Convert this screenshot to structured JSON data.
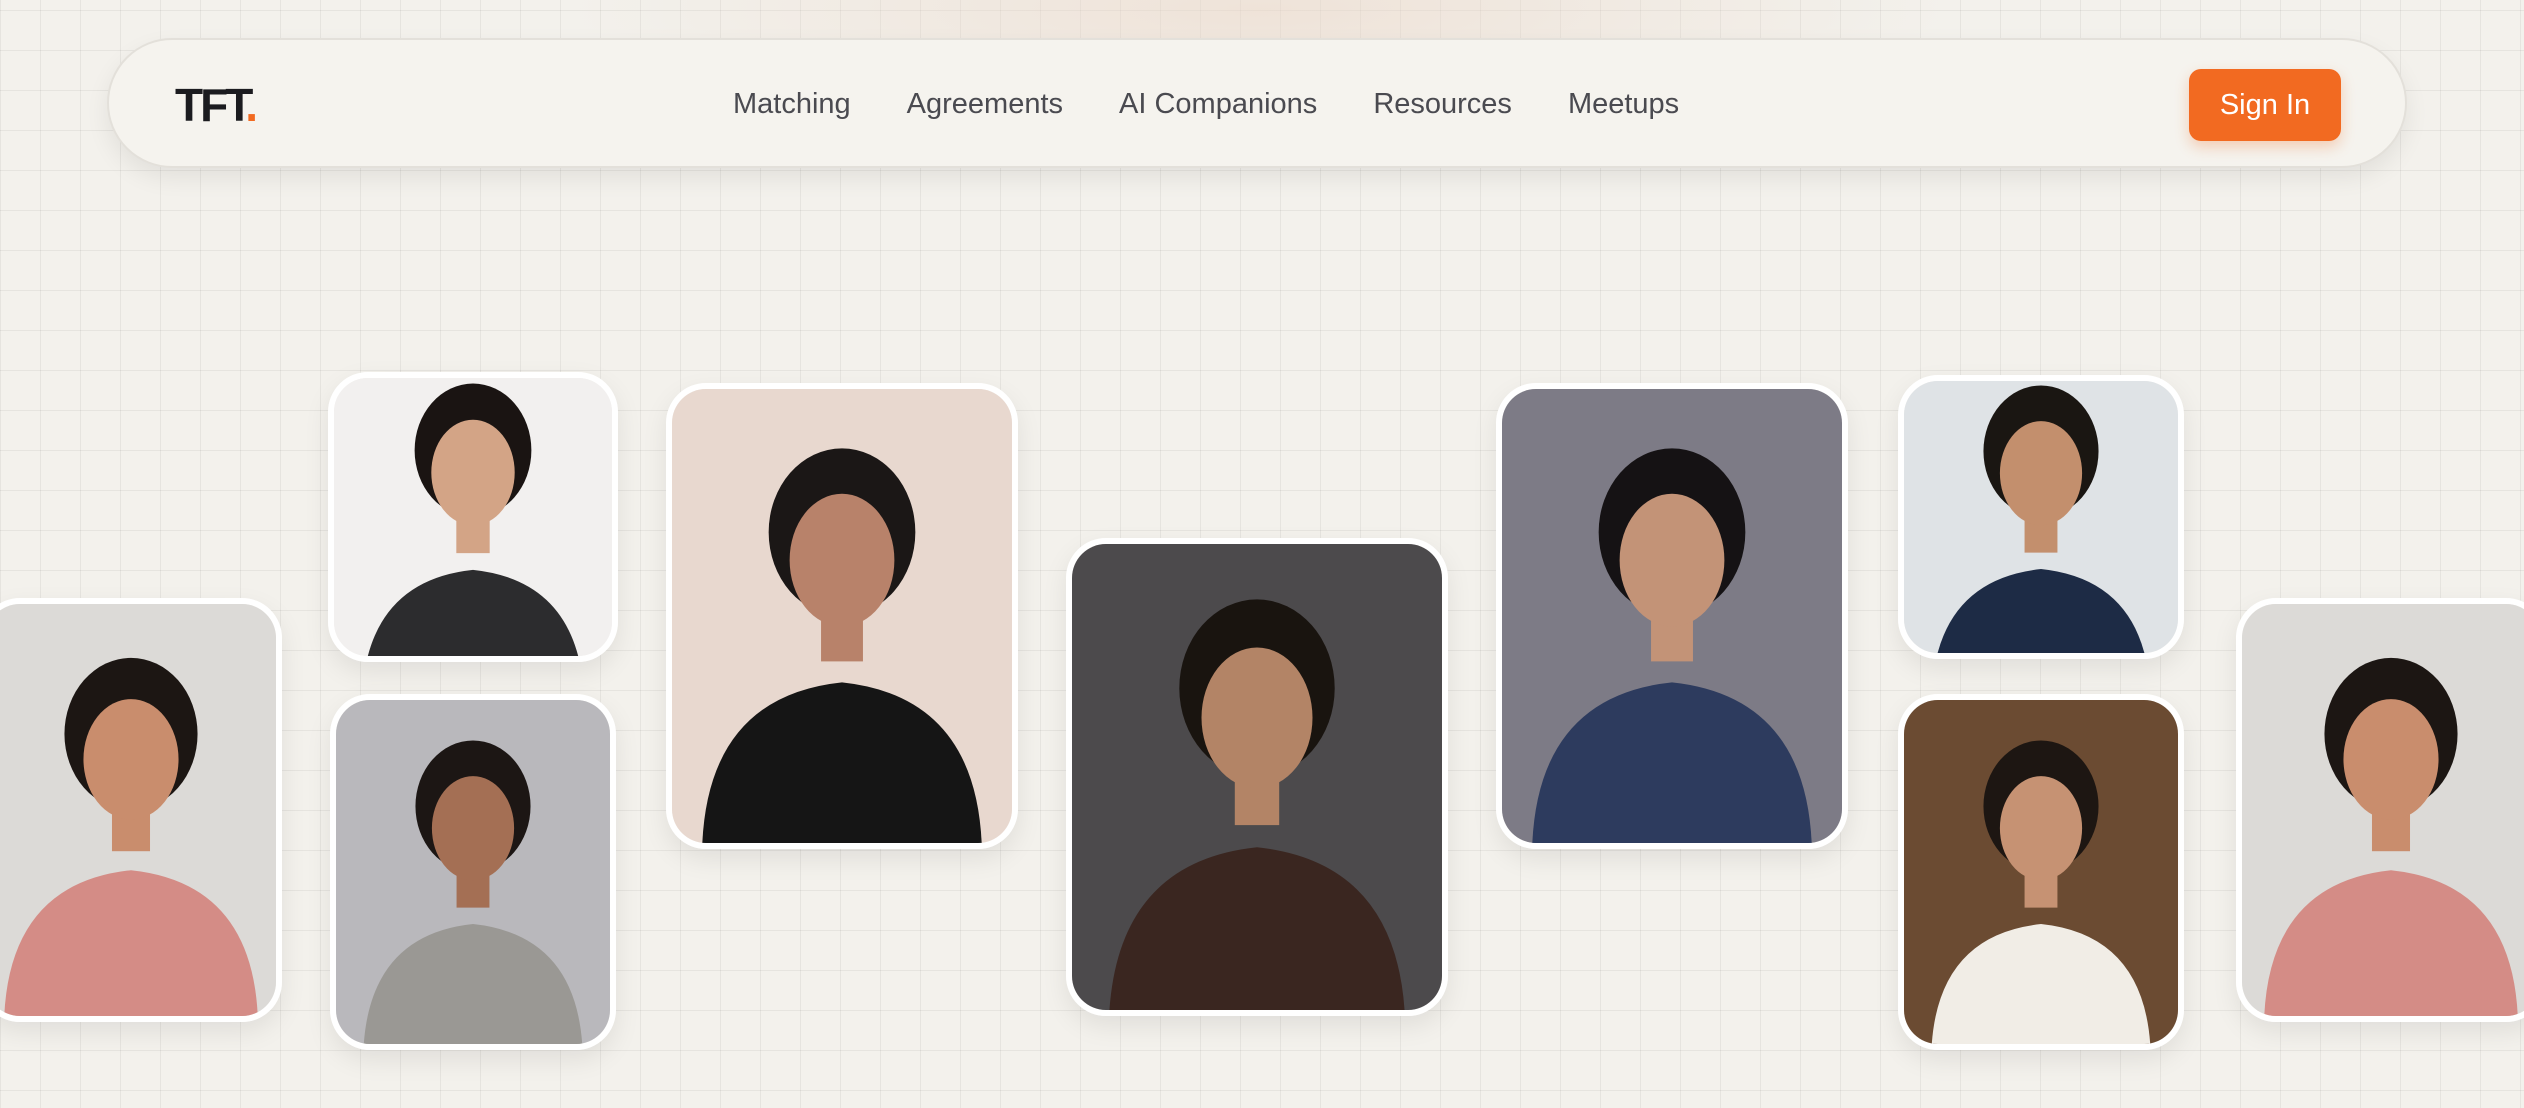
{
  "brand": {
    "name": "TFT",
    "dot": "."
  },
  "nav": {
    "items": [
      "Matching",
      "Agreements",
      "AI Companions",
      "Resources",
      "Meetups"
    ],
    "signin_label": "Sign In"
  },
  "colors": {
    "accent": "#f26a21",
    "background": "#f3f1ec",
    "text": "#4a4a50"
  },
  "gallery": [
    {
      "name": "profile-photo-woman-pink-top",
      "bg": "#dcdad7",
      "hair": "#1c1613",
      "skin": "#c98d6d",
      "cloth": "#d48c86"
    },
    {
      "name": "profile-photo-woman-black-top",
      "bg": "#f2f0ef",
      "hair": "#1a1412",
      "skin": "#d3a486",
      "cloth": "#2c2c2e"
    },
    {
      "name": "profile-photo-woman-saree",
      "bg": "#b9b8bc",
      "hair": "#1c1614",
      "skin": "#a46f54",
      "cloth": "#9a9894"
    },
    {
      "name": "profile-photo-man-boat-tshirt",
      "bg": "#e8d8cf",
      "hair": "#1b1716",
      "skin": "#b8826a",
      "cloth": "#151515"
    },
    {
      "name": "profile-photo-man-brown-jacket",
      "bg": "#4c4a4c",
      "hair": "#19140f",
      "skin": "#b38466",
      "cloth": "#3a2620"
    },
    {
      "name": "profile-photo-man-blue-blazer",
      "bg": "#7d7b86",
      "hair": "#151214",
      "skin": "#c39377",
      "cloth": "#2d3b5e"
    },
    {
      "name": "profile-photo-man-navy-polo",
      "bg": "#dfe3e6",
      "hair": "#1a1612",
      "skin": "#c38f6d",
      "cloth": "#1d2b45"
    },
    {
      "name": "profile-photo-woman-white-top",
      "bg": "#6b4b32",
      "hair": "#1d1612",
      "skin": "#c69273",
      "cloth": "#f1ede6"
    },
    {
      "name": "profile-photo-woman-pink-top-repeat",
      "bg": "#dcdad7",
      "hair": "#1c1613",
      "skin": "#c98d6d",
      "cloth": "#d48c86"
    }
  ]
}
